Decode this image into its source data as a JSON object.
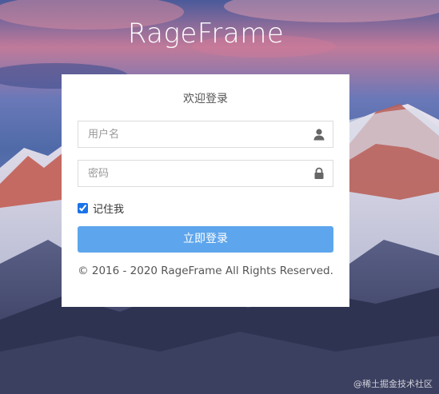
{
  "app": {
    "brand_title": "RageFrame"
  },
  "login": {
    "title": "欢迎登录",
    "username_placeholder": "用户名",
    "password_placeholder": "密码",
    "remember_label": "记住我",
    "remember_checked": true,
    "submit_label": "立即登录",
    "copyright": "© 2016 - 2020 RageFrame All Rights Reserved."
  },
  "watermark": "@稀土掘金技术社区",
  "icons": {
    "username": "user-icon",
    "password": "lock-icon"
  },
  "colors": {
    "button": "#5da5ec",
    "checkbox": "#1a73e8",
    "card": "#ffffff"
  }
}
